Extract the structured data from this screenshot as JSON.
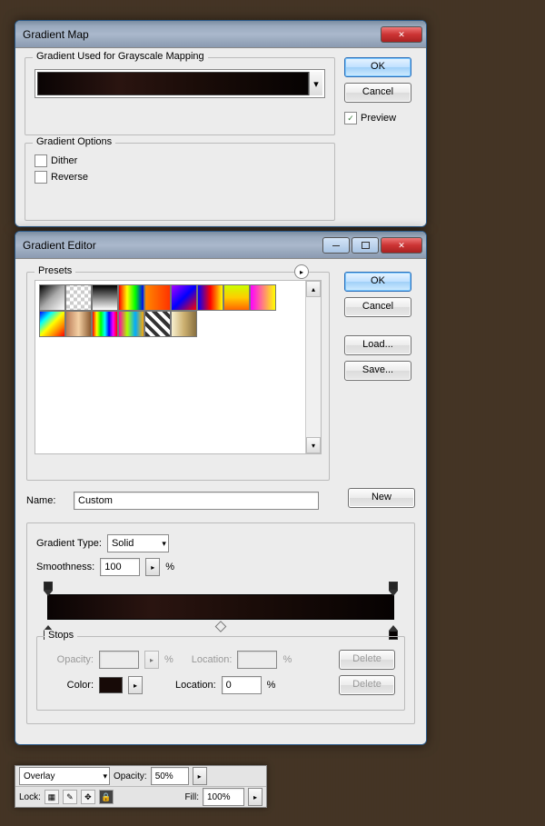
{
  "gradientMap": {
    "title": "Gradient Map",
    "groupGrayscale": "Gradient Used for Grayscale Mapping",
    "groupOptions": "Gradient Options",
    "dither": "Dither",
    "reverse": "Reverse",
    "ok": "OK",
    "cancel": "Cancel",
    "preview": "Preview",
    "previewChecked": "✓"
  },
  "gradientEditor": {
    "title": "Gradient Editor",
    "presets": "Presets",
    "ok": "OK",
    "cancel": "Cancel",
    "load": "Load...",
    "save": "Save...",
    "nameLabel": "Name:",
    "nameValue": "Custom",
    "new": "New",
    "gradientTypeLabel": "Gradient Type:",
    "gradientTypeValue": "Solid",
    "smoothnessLabel": "Smoothness:",
    "smoothnessValue": "100",
    "percent": "%",
    "stops": {
      "title": "Stops",
      "opacity": "Opacity:",
      "location": "Location:",
      "locationValue": "0",
      "color": "Color:",
      "delete": "Delete"
    }
  },
  "layerBar": {
    "blendMode": "Overlay",
    "opacityLabel": "Opacity:",
    "opacityValue": "50%",
    "lockLabel": "Lock:",
    "fillLabel": "Fill:",
    "fillValue": "100%"
  }
}
